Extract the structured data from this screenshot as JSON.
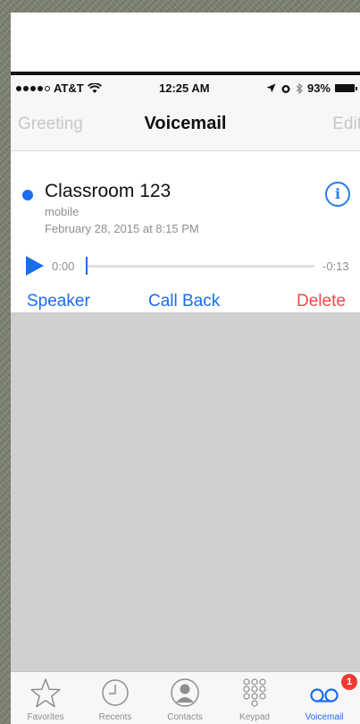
{
  "status_bar": {
    "carrier": "AT&T",
    "time": "12:25 AM",
    "battery": "93%"
  },
  "nav": {
    "left": "Greeting",
    "title": "Voicemail",
    "right": "Edit"
  },
  "voicemail": {
    "caller": "Classroom 123",
    "type": "mobile",
    "date": "February 28, 2015 at 8:15 PM",
    "elapsed": "0:00",
    "remaining": "-0:13",
    "progress": 0.0,
    "actions": {
      "speaker": "Speaker",
      "call_back": "Call Back",
      "delete": "Delete"
    }
  },
  "tabs": [
    {
      "label": "Favorites",
      "icon": "star-icon"
    },
    {
      "label": "Recents",
      "icon": "clock-icon"
    },
    {
      "label": "Contacts",
      "icon": "person-icon"
    },
    {
      "label": "Keypad",
      "icon": "keypad-icon"
    },
    {
      "label": "Voicemail",
      "icon": "voicemail-icon",
      "badge": "1",
      "active": true
    }
  ],
  "colors": {
    "accent": "#1a6cf0",
    "destructive": "#f2494a",
    "badge": "#f23a32"
  }
}
